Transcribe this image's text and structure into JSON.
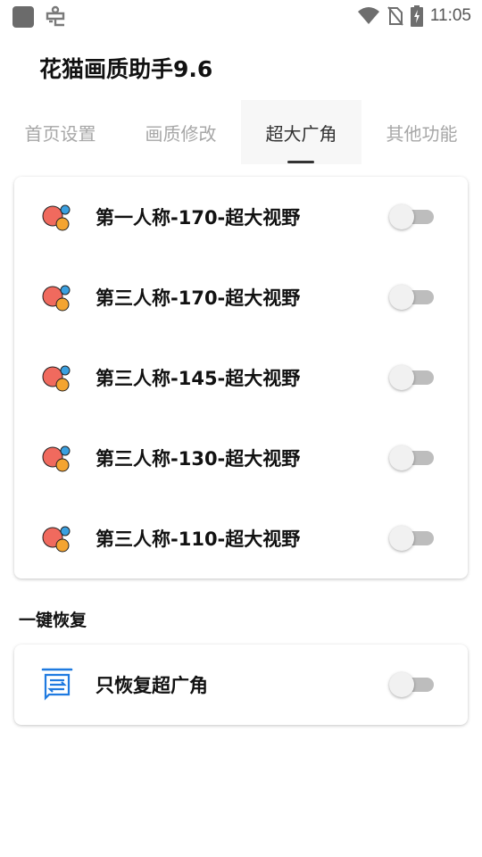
{
  "status_bar": {
    "time": "11:05",
    "left_icons": [
      "app-square-icon",
      "bug-icon"
    ],
    "right_icons": [
      "wifi-icon",
      "no-sim-icon",
      "battery-charging-icon"
    ]
  },
  "app": {
    "title": "花猫画质助手9.6"
  },
  "tabs": [
    {
      "label": "首页设置",
      "active": false
    },
    {
      "label": "画质修改",
      "active": false
    },
    {
      "label": "超大广角",
      "active": true
    },
    {
      "label": "其他功能",
      "active": false
    }
  ],
  "fov_options": [
    {
      "label": "第一人称-170-超大视野",
      "icon": "bubbles-icon",
      "enabled": false
    },
    {
      "label": "第三人称-170-超大视野",
      "icon": "bubbles-icon",
      "enabled": false
    },
    {
      "label": "第三人称-145-超大视野",
      "icon": "bubbles-icon",
      "enabled": false
    },
    {
      "label": "第三人称-130-超大视野",
      "icon": "bubbles-icon",
      "enabled": false
    },
    {
      "label": "第三人称-110-超大视野",
      "icon": "bubbles-icon",
      "enabled": false
    }
  ],
  "restore_section": {
    "title": "一键恢复",
    "items": [
      {
        "label": "只恢复超广角",
        "icon": "restore-list-icon",
        "enabled": false
      }
    ]
  },
  "colors": {
    "bubble_red": "#f06a5e",
    "bubble_orange": "#f4a431",
    "bubble_blue": "#3aa0e0",
    "restore_icon_blue": "#1f7ae0",
    "toggle_track_off": "#bdbdbd",
    "toggle_knob": "#f1f1f1"
  }
}
